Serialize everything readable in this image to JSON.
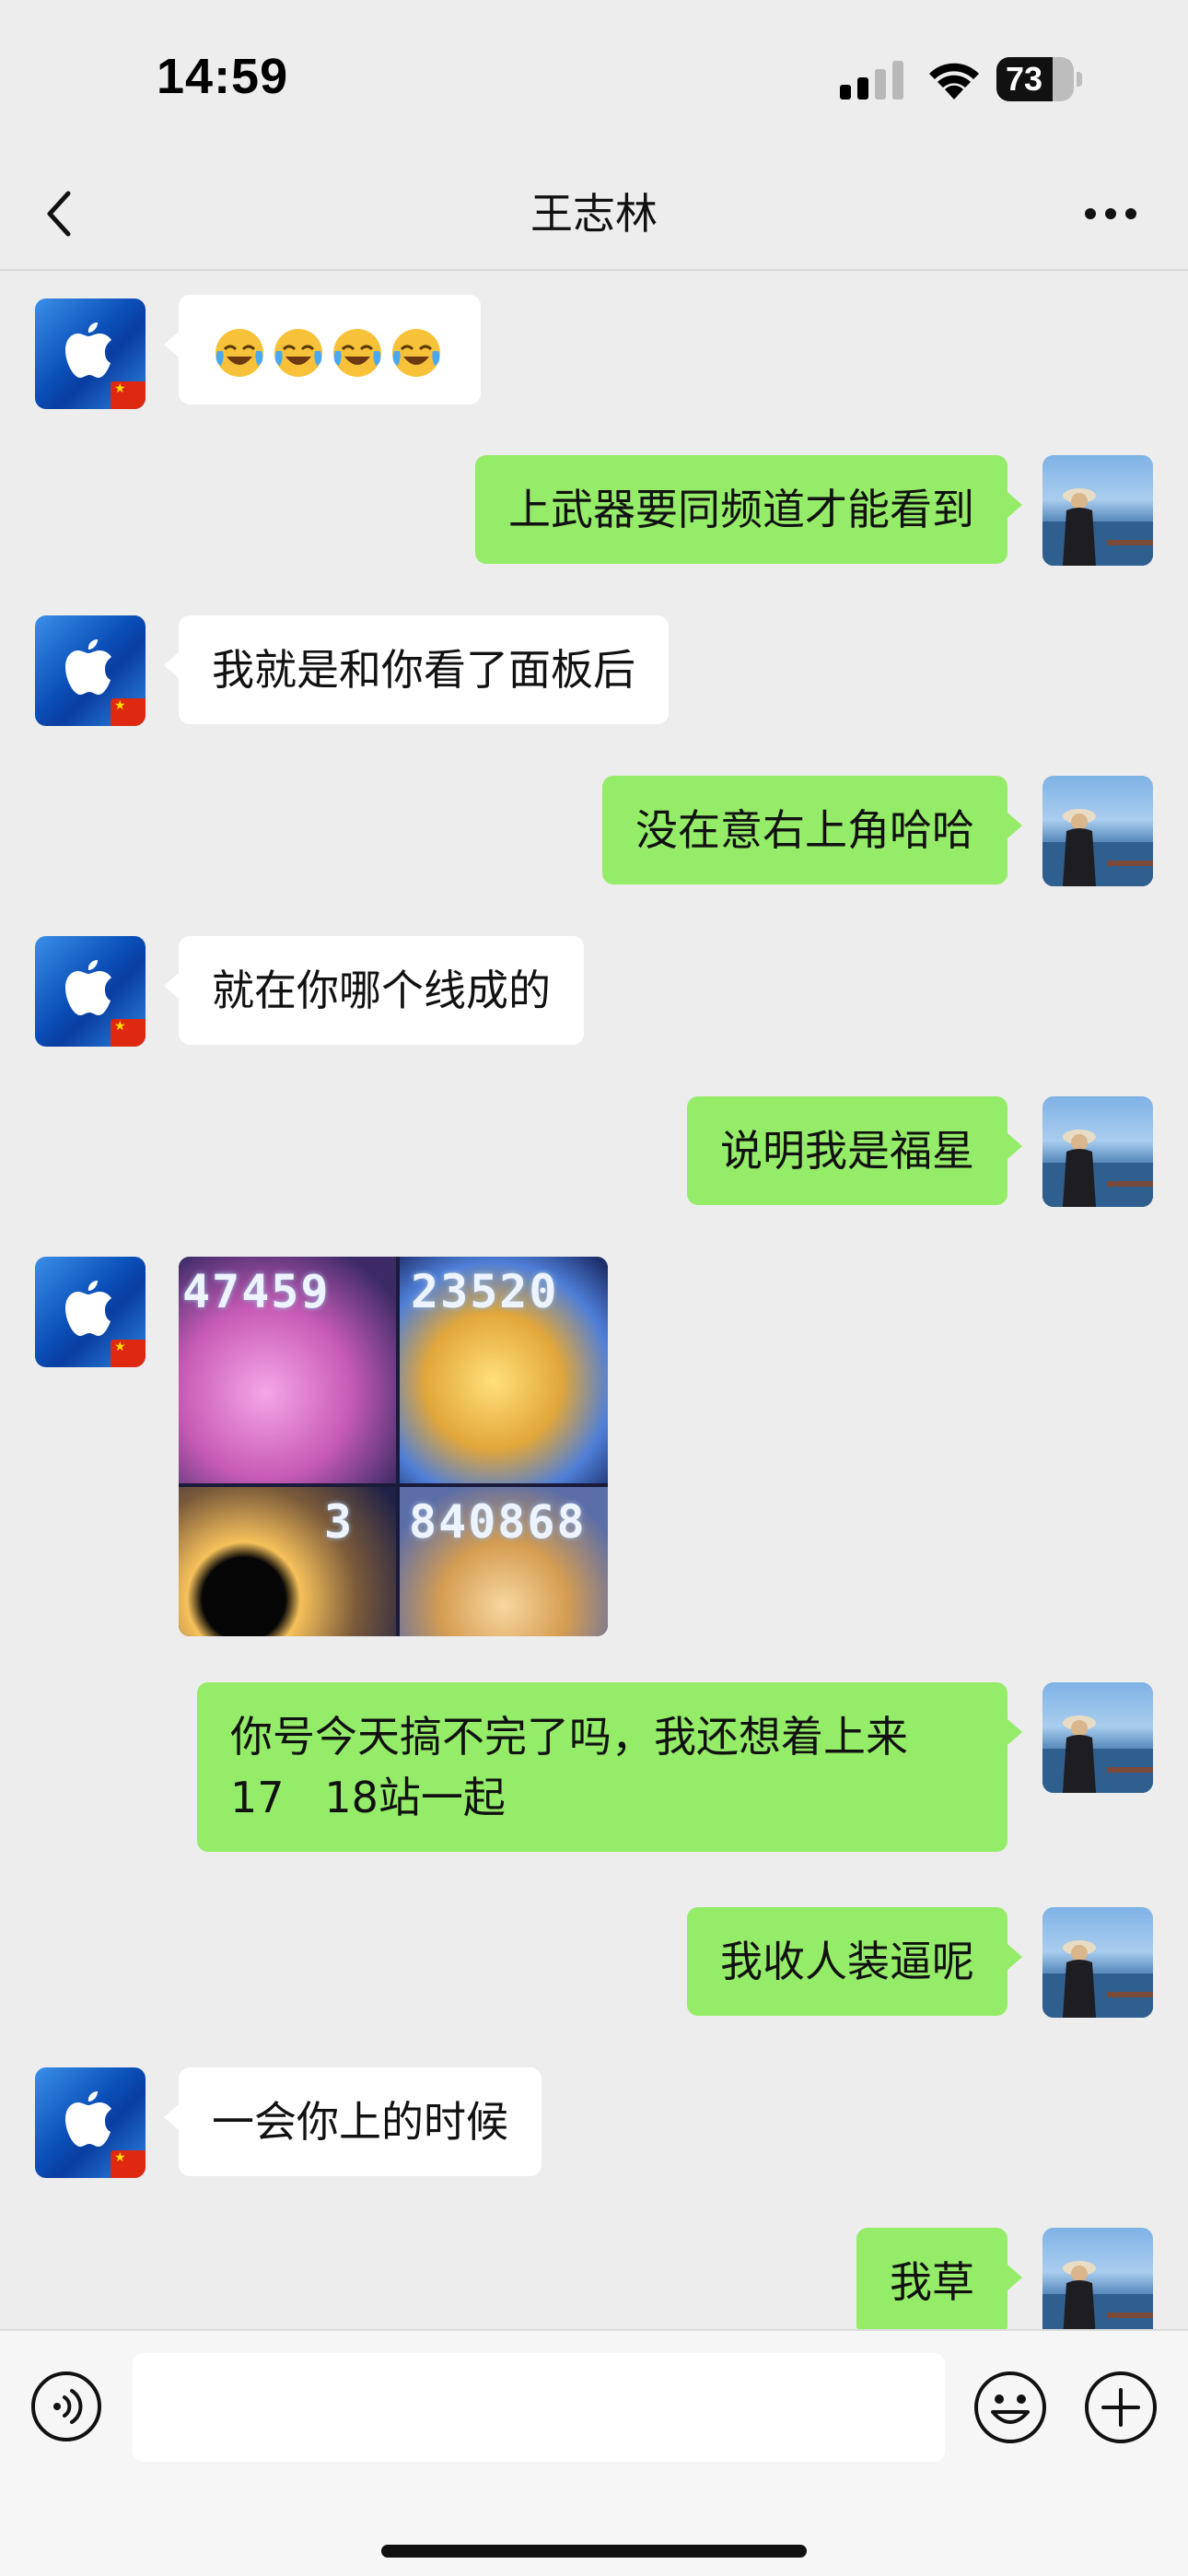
{
  "status_bar": {
    "time": "14:59",
    "battery": "73",
    "battery_level": 0.73
  },
  "nav": {
    "title": "王志林"
  },
  "messages": [
    {
      "side": "in",
      "type": "emoji",
      "emoji_names": [
        "face-with-tears-of-joy",
        "face-with-tears-of-joy",
        "face-with-tears-of-joy",
        "face-with-tears-of-joy"
      ]
    },
    {
      "side": "out",
      "text": "上武器要同频道才能看到"
    },
    {
      "side": "in",
      "text": "我就是和你看了面板后"
    },
    {
      "side": "out",
      "text": "没在意右上角哈哈"
    },
    {
      "side": "in",
      "text": "就在你哪个线成的"
    },
    {
      "side": "out",
      "text": "说明我是福星"
    },
    {
      "side": "in",
      "type": "image",
      "image_numbers": [
        "47459",
        "23520",
        "3",
        "840868"
      ]
    },
    {
      "side": "out",
      "text_line1": "你号今天搞不完了吗，我还想着上来",
      "text_line2": "17   18站一起"
    },
    {
      "side": "out",
      "text": "我收人装逼呢"
    },
    {
      "side": "in",
      "text": "一会你上的时候"
    },
    {
      "side": "out",
      "text": "我草"
    }
  ],
  "input_bar": {
    "placeholder": ""
  },
  "colors": {
    "background": "#ededed",
    "bubble_out": "#95ec69",
    "bubble_in": "#ffffff"
  },
  "icons": {
    "back": "chevron-left-icon",
    "more": "more-dots-icon",
    "voice": "voice-icon",
    "emoji": "emoji-icon",
    "plus": "plus-icon",
    "wifi": "wifi-icon",
    "cellular": "cellular-signal-icon"
  }
}
